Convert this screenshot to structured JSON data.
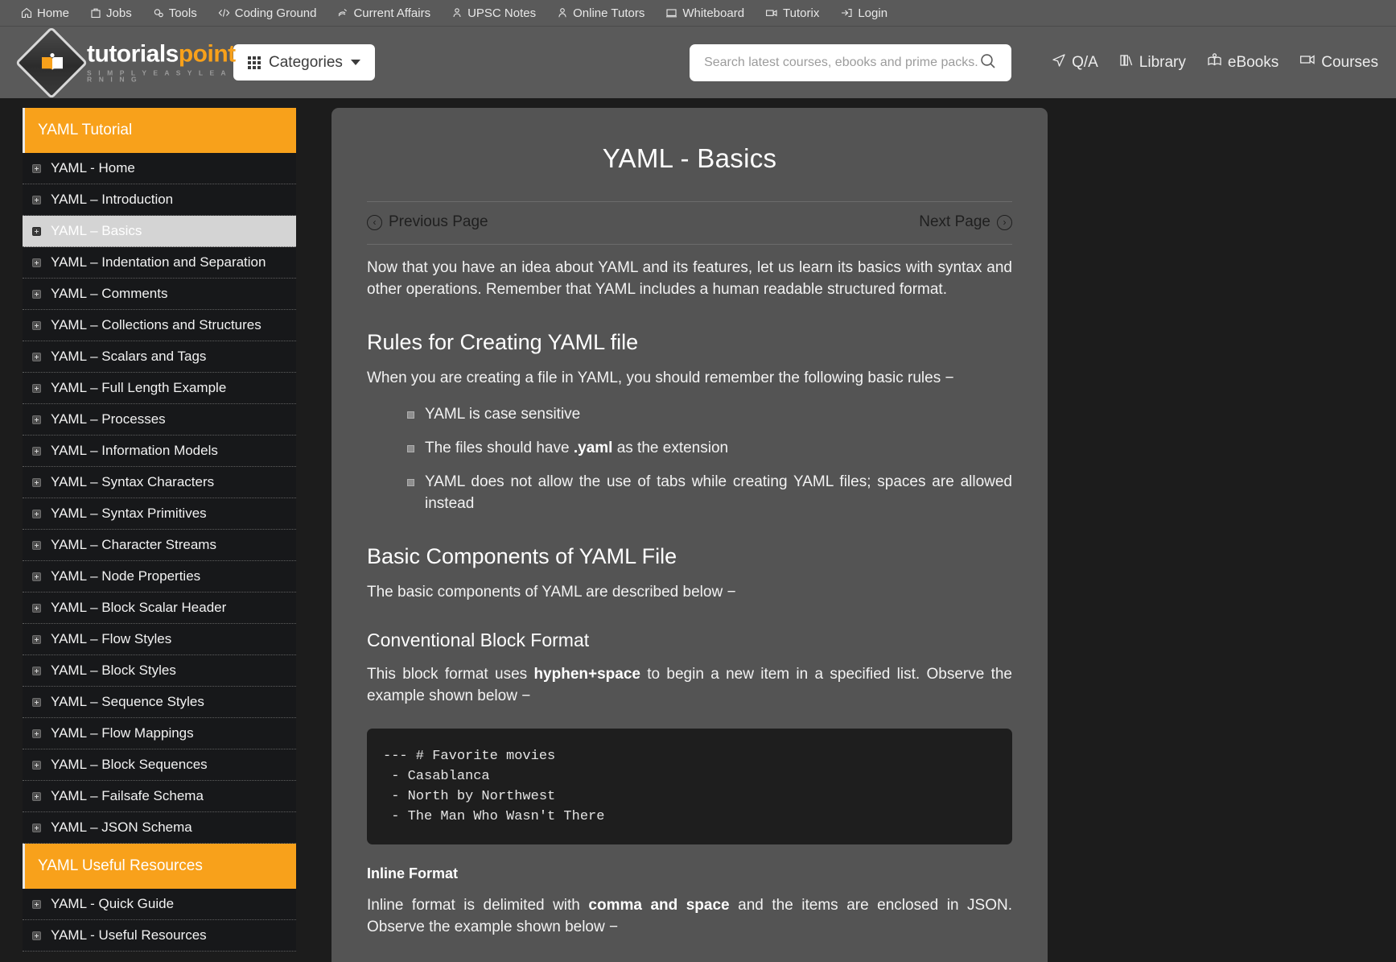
{
  "topbar": {
    "items": [
      {
        "label": "Home",
        "icon": "home-icon"
      },
      {
        "label": "Jobs",
        "icon": "briefcase-icon"
      },
      {
        "label": "Tools",
        "icon": "gear-icon"
      },
      {
        "label": "Coding Ground",
        "icon": "code-icon"
      },
      {
        "label": "Current Affairs",
        "icon": "news-icon"
      },
      {
        "label": "UPSC Notes",
        "icon": "notes-icon"
      },
      {
        "label": "Online Tutors",
        "icon": "person-icon"
      },
      {
        "label": "Whiteboard",
        "icon": "whiteboard-icon"
      },
      {
        "label": "Tutorix",
        "icon": "video-icon"
      },
      {
        "label": "Login",
        "icon": "login-icon"
      }
    ]
  },
  "header": {
    "logo": {
      "name_part1": "tutorials",
      "name_part2": "point",
      "tagline": "S I M P L Y E A S Y L E A R N I N G"
    },
    "categories_label": "Categories",
    "search": {
      "placeholder": "Search latest courses, ebooks and prime packs...",
      "value": ""
    },
    "links": [
      {
        "label": "Q/A",
        "icon": "send-icon"
      },
      {
        "label": "Library",
        "icon": "books-icon"
      },
      {
        "label": "eBooks",
        "icon": "open-book-icon"
      },
      {
        "label": "Courses",
        "icon": "monitor-icon"
      }
    ]
  },
  "sidebar": {
    "section1_title": "YAML Tutorial",
    "section1_items": [
      {
        "label": "YAML - Home",
        "active": false
      },
      {
        "label": "YAML – Introduction",
        "active": false
      },
      {
        "label": "YAML – Basics",
        "active": true
      },
      {
        "label": "YAML – Indentation and Separation",
        "active": false
      },
      {
        "label": "YAML – Comments",
        "active": false
      },
      {
        "label": "YAML – Collections and Structures",
        "active": false
      },
      {
        "label": "YAML – Scalars and Tags",
        "active": false
      },
      {
        "label": "YAML – Full Length Example",
        "active": false
      },
      {
        "label": "YAML – Processes",
        "active": false
      },
      {
        "label": "YAML – Information Models",
        "active": false
      },
      {
        "label": "YAML – Syntax Characters",
        "active": false
      },
      {
        "label": "YAML – Syntax Primitives",
        "active": false
      },
      {
        "label": "YAML – Character Streams",
        "active": false
      },
      {
        "label": "YAML – Node Properties",
        "active": false
      },
      {
        "label": "YAML – Block Scalar Header",
        "active": false
      },
      {
        "label": "YAML – Flow Styles",
        "active": false
      },
      {
        "label": "YAML – Block Styles",
        "active": false
      },
      {
        "label": "YAML – Sequence Styles",
        "active": false
      },
      {
        "label": "YAML – Flow Mappings",
        "active": false
      },
      {
        "label": "YAML – Block Sequences",
        "active": false
      },
      {
        "label": "YAML – Failsafe Schema",
        "active": false
      },
      {
        "label": "YAML – JSON Schema",
        "active": false
      }
    ],
    "section2_title": "YAML Useful Resources",
    "section2_items": [
      {
        "label": "YAML - Quick Guide",
        "active": false
      },
      {
        "label": "YAML - Useful Resources",
        "active": false
      }
    ]
  },
  "content": {
    "title": "YAML - Basics",
    "prev_label": "Previous Page",
    "next_label": "Next Page",
    "prev_icon": "chevron-left-circle-icon",
    "next_icon": "chevron-right-circle-icon",
    "intro": "Now that you have an idea about YAML and its features, let us learn its basics with syntax and other operations. Remember that YAML includes a human readable structured format.",
    "rules_heading": "Rules for Creating YAML file",
    "rules_intro": "When you are creating a file in YAML, you should remember the following basic rules −",
    "rules": [
      {
        "pre": "YAML is case sensitive",
        "bold": "",
        "post": ""
      },
      {
        "pre": "The files should have ",
        "bold": ".yaml",
        "post": " as the extension"
      },
      {
        "pre": "YAML does not allow the use of tabs while creating YAML files; spaces are allowed instead",
        "bold": "",
        "post": ""
      }
    ],
    "components_heading": "Basic Components of YAML File",
    "components_intro": "The basic components of YAML are described below −",
    "block_format_heading": "Conventional Block Format",
    "block_format_pre": "This block format uses ",
    "block_format_bold": "hyphen+space",
    "block_format_post": " to begin a new item in a specified list. Observe the example shown below −",
    "code_block": "--- # Favorite movies\n - Casablanca\n - North by Northwest\n - The Man Who Wasn't There",
    "inline_heading": "Inline Format",
    "inline_pre": "Inline format is delimited with ",
    "inline_bold": "comma and space",
    "inline_post": " and the items are enclosed in JSON. Observe the example shown below −"
  },
  "colors": {
    "accent_orange": "#f8a11b",
    "page_bg": "#1c1c1c",
    "panel_bg": "#545454",
    "topbar_bg": "#5a5a5a",
    "sidebar_item_bg": "#17181a",
    "sidebar_active_bg": "#d4d4d4",
    "code_bg": "#1e1e1e"
  }
}
